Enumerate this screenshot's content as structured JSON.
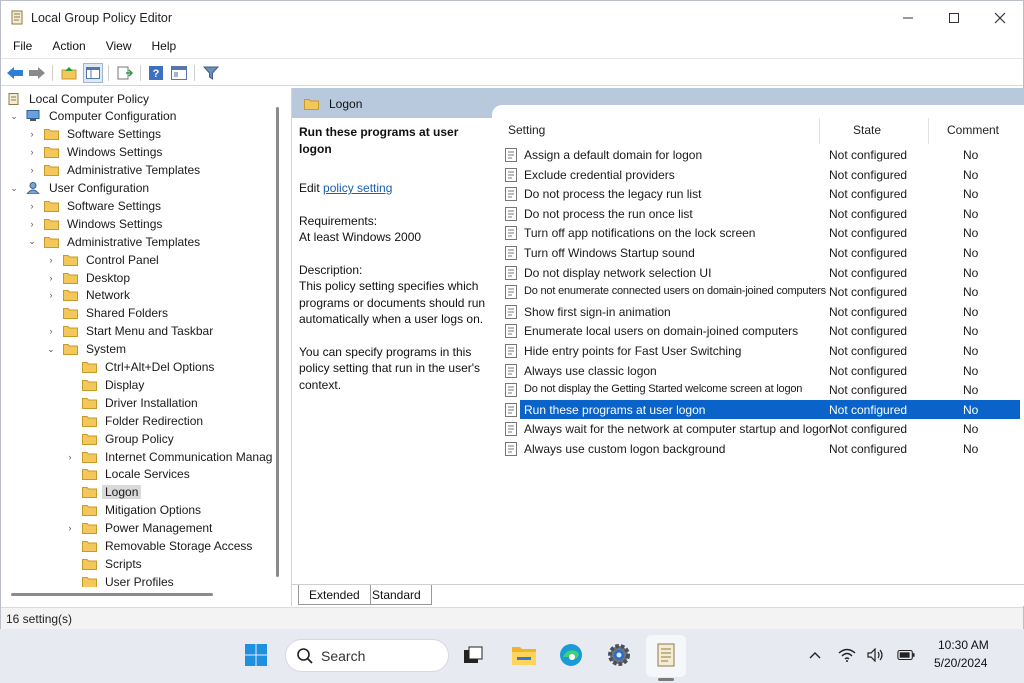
{
  "window": {
    "title": "Local Group Policy Editor"
  },
  "menu": [
    "File",
    "Action",
    "View",
    "Help"
  ],
  "toolbar": {
    "icons": [
      "back-arrow-icon",
      "forward-arrow-icon",
      "up-folder-icon",
      "show-hide-tree-icon",
      "export-list-icon",
      "help-icon",
      "properties-icon",
      "filter-icon"
    ]
  },
  "tree": [
    {
      "label": "Local Computer Policy",
      "level": 0,
      "expander": "",
      "icon": "policy-icon"
    },
    {
      "label": "Computer Configuration",
      "level": 0,
      "expander": "v",
      "icon": "computer-icon",
      "indent": 1
    },
    {
      "label": "Software Settings",
      "level": 1,
      "expander": ">",
      "icon": "folder-icon"
    },
    {
      "label": "Windows Settings",
      "level": 1,
      "expander": ">",
      "icon": "folder-icon"
    },
    {
      "label": "Administrative Templates",
      "level": 1,
      "expander": ">",
      "icon": "folder-icon"
    },
    {
      "label": "User Configuration",
      "level": 0,
      "expander": "v",
      "icon": "user-icon",
      "indent": 1
    },
    {
      "label": "Software Settings",
      "level": 1,
      "expander": ">",
      "icon": "folder-icon"
    },
    {
      "label": "Windows Settings",
      "level": 1,
      "expander": ">",
      "icon": "folder-icon"
    },
    {
      "label": "Administrative Templates",
      "level": 1,
      "expander": "v",
      "icon": "folder-icon"
    },
    {
      "label": "Control Panel",
      "level": 2,
      "expander": ">",
      "icon": "folder-icon"
    },
    {
      "label": "Desktop",
      "level": 2,
      "expander": ">",
      "icon": "folder-icon"
    },
    {
      "label": "Network",
      "level": 2,
      "expander": ">",
      "icon": "folder-icon"
    },
    {
      "label": "Shared Folders",
      "level": 2,
      "expander": "",
      "icon": "folder-icon"
    },
    {
      "label": "Start Menu and Taskbar",
      "level": 2,
      "expander": ">",
      "icon": "folder-icon"
    },
    {
      "label": "System",
      "level": 2,
      "expander": "v",
      "icon": "folder-icon"
    },
    {
      "label": "Ctrl+Alt+Del Options",
      "level": 3,
      "expander": "",
      "icon": "folder-icon"
    },
    {
      "label": "Display",
      "level": 3,
      "expander": "",
      "icon": "folder-icon"
    },
    {
      "label": "Driver Installation",
      "level": 3,
      "expander": "",
      "icon": "folder-icon"
    },
    {
      "label": "Folder Redirection",
      "level": 3,
      "expander": "",
      "icon": "folder-icon"
    },
    {
      "label": "Group Policy",
      "level": 3,
      "expander": "",
      "icon": "folder-icon"
    },
    {
      "label": "Internet Communication Manag",
      "level": 3,
      "expander": ">",
      "icon": "folder-icon"
    },
    {
      "label": "Locale Services",
      "level": 3,
      "expander": "",
      "icon": "folder-icon"
    },
    {
      "label": "Logon",
      "level": 3,
      "expander": "",
      "icon": "folder-icon",
      "selected": true
    },
    {
      "label": "Mitigation Options",
      "level": 3,
      "expander": "",
      "icon": "folder-icon"
    },
    {
      "label": "Power Management",
      "level": 3,
      "expander": ">",
      "icon": "folder-icon"
    },
    {
      "label": "Removable Storage Access",
      "level": 3,
      "expander": "",
      "icon": "folder-icon"
    },
    {
      "label": "Scripts",
      "level": 3,
      "expander": "",
      "icon": "folder-icon"
    },
    {
      "label": "User Profiles",
      "level": 3,
      "expander": "",
      "icon": "folder-icon"
    }
  ],
  "header": {
    "title": "Logon"
  },
  "description": {
    "title": "Run these programs at user logon",
    "edit_prefix": "Edit",
    "edit_link": "policy setting",
    "requirements_label": "Requirements:",
    "requirements_value": "At least Windows 2000",
    "description_label": "Description:",
    "description_text": "This policy setting specifies which programs or documents should run automatically when a user logs on.",
    "extra_text": "You can specify programs in this policy setting that run in the user's context."
  },
  "columns": {
    "setting": "Setting",
    "state": "State",
    "comment": "Comment"
  },
  "settings": [
    {
      "name": "Assign a default domain for logon",
      "state": "Not configured",
      "comment": "No"
    },
    {
      "name": "Exclude credential providers",
      "state": "Not configured",
      "comment": "No"
    },
    {
      "name": "Do not process the legacy run list",
      "state": "Not configured",
      "comment": "No"
    },
    {
      "name": "Do not process the run once list",
      "state": "Not configured",
      "comment": "No"
    },
    {
      "name": "Turn off app notifications on the lock screen",
      "state": "Not configured",
      "comment": "No"
    },
    {
      "name": "Turn off Windows Startup sound",
      "state": "Not configured",
      "comment": "No"
    },
    {
      "name": "Do not display network selection UI",
      "state": "Not configured",
      "comment": "No"
    },
    {
      "name": "Do not enumerate connected users on domain-joined computers",
      "state": "Not configured",
      "comment": "No",
      "narrow": true
    },
    {
      "name": "Show first sign-in animation",
      "state": "Not configured",
      "comment": "No"
    },
    {
      "name": "Enumerate local users on domain-joined computers",
      "state": "Not configured",
      "comment": "No"
    },
    {
      "name": "Hide entry points for Fast User Switching",
      "state": "Not configured",
      "comment": "No"
    },
    {
      "name": "Always use classic logon",
      "state": "Not configured",
      "comment": "No"
    },
    {
      "name": "Do not display the Getting Started welcome screen at logon",
      "state": "Not configured",
      "comment": "No",
      "narrow": true
    },
    {
      "name": "Run these programs at user logon",
      "state": "Not configured",
      "comment": "No",
      "selected": true
    },
    {
      "name": "Always wait for the network at computer startup and logon",
      "state": "Not configured",
      "comment": "No"
    },
    {
      "name": "Always use custom logon background",
      "state": "Not configured",
      "comment": "No"
    }
  ],
  "tabs": [
    "Extended",
    "Standard"
  ],
  "status": "16 setting(s)",
  "taskbar": {
    "search_placeholder": "Search",
    "time": "10:30 AM",
    "date": "5/20/2024",
    "apps": [
      "start-icon",
      "task-view-icon",
      "file-explorer-icon",
      "edge-icon",
      "settings-icon",
      "group-policy-app-icon"
    ],
    "tray": [
      "chevron-up-icon",
      "wifi-icon",
      "volume-icon",
      "battery-icon"
    ]
  },
  "colors": {
    "selection": "#0a63c9",
    "header_band": "#b8c8dd",
    "folder": "#f3c75a",
    "link": "#1a5fb4"
  }
}
